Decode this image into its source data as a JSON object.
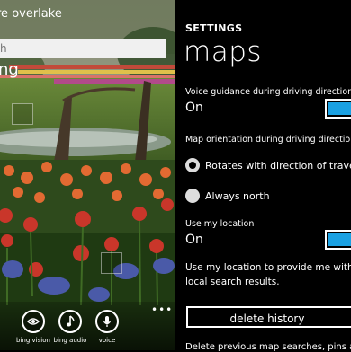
{
  "left_panel": {
    "title": "re overlake",
    "search_placeholder": "h",
    "logo_text": "ng",
    "apps": [
      {
        "label": "bing vision",
        "icon": "eye-icon"
      },
      {
        "label": "bing audio",
        "icon": "music-note-icon"
      },
      {
        "label": "voice",
        "icon": "microphone-icon"
      }
    ],
    "more": "•••"
  },
  "settings": {
    "header": "SETTINGS",
    "title": "maps",
    "voice_guidance": {
      "label": "Voice guidance during driving directions",
      "value": "On",
      "on": true
    },
    "orientation": {
      "label": "Map orientation during driving directions",
      "options": [
        {
          "label": "Rotates with direction of travel",
          "selected": true
        },
        {
          "label": "Always north",
          "selected": false
        }
      ]
    },
    "location": {
      "label": "Use my location",
      "value": "On",
      "on": true
    },
    "location_desc_line1": "Use my location to provide me with be",
    "location_desc_line2": "local search results.",
    "delete_history_label": "delete history",
    "bottom_text": "Delete previous map searches, pins a"
  },
  "colors": {
    "accent": "#1ba1e2",
    "background": "#000000",
    "text": "#ffffff"
  }
}
